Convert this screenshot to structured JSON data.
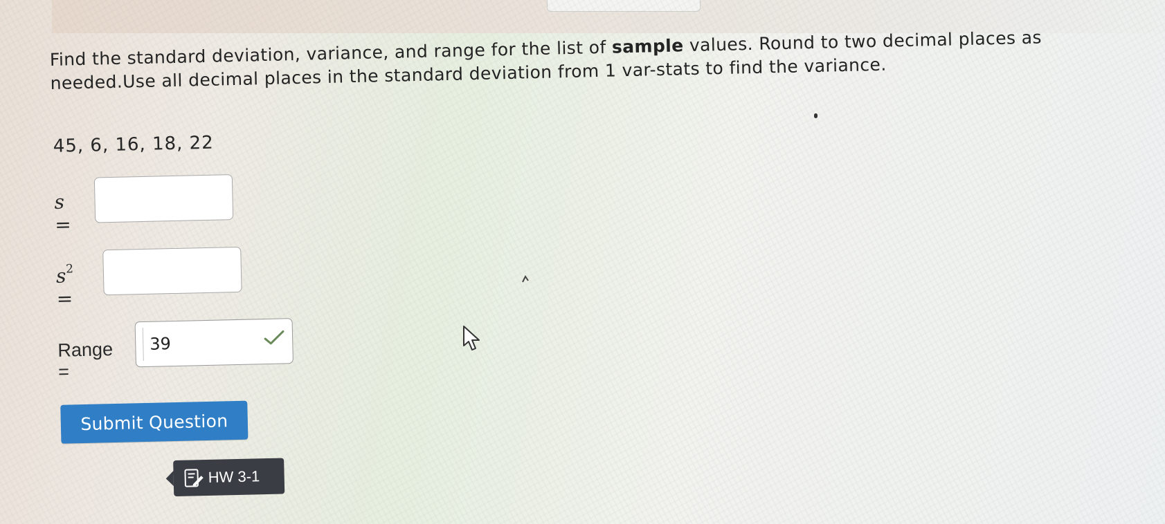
{
  "question": {
    "text_before": "Find the standard deviation, variance, and range for the list of ",
    "text_bold": "sample",
    "text_after": " values. Round to two decimal places as needed.Use all decimal places in the standard deviation from 1 var-stats to find the variance."
  },
  "values_list": "45, 6, 16, 18, 22",
  "fields": {
    "s_label": "s =",
    "s_value": "",
    "s2_label_base": "s",
    "s2_label_exp": "2",
    "s2_label_eq": " =",
    "s2_value": "",
    "range_label": "Range =",
    "range_value": "39"
  },
  "buttons": {
    "submit_label": "Submit Question"
  },
  "badge": {
    "label": "HW 3-1"
  },
  "colors": {
    "submit_bg": "#2f7ec6",
    "badge_bg": "#3a3d43",
    "check_color": "#6a8a5a"
  }
}
